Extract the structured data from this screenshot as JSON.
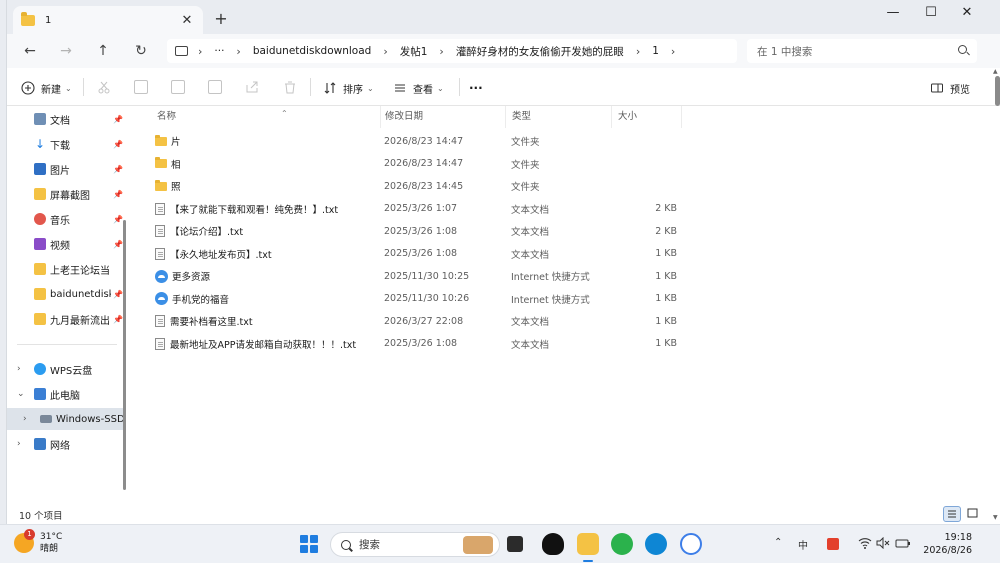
{
  "tab": {
    "title": "1",
    "close": "✕",
    "new_tab": "+"
  },
  "window_controls": {
    "minimize": "—",
    "maximize": "☐",
    "close": "✕"
  },
  "nav": {
    "back": "←",
    "forward": "→",
    "up": "↑",
    "refresh": "↻"
  },
  "address": {
    "ellipsis": "···",
    "crumbs": [
      "baidunetdiskdownload",
      "发帖1",
      "灌醉好身材的女友偷偷开发她的屁眼",
      "1"
    ],
    "sep": "›"
  },
  "search": {
    "placeholder": "在 1 中搜索"
  },
  "toolbar": {
    "new_label": "新建",
    "sort_label": "排序",
    "view_label": "查看",
    "more_label": "···",
    "preview_label": "预览"
  },
  "sidebar": {
    "quick": [
      {
        "label": "文档",
        "pin": "📌"
      },
      {
        "label": "下载",
        "pin": "📌"
      },
      {
        "label": "图片",
        "pin": "📌"
      },
      {
        "label": "屏幕截图",
        "pin": "📌"
      },
      {
        "label": "音乐",
        "pin": "📌"
      },
      {
        "label": "视频",
        "pin": "📌"
      },
      {
        "label": "上老王论坛当",
        "pin": ""
      },
      {
        "label": "baidunetdisk",
        "pin": "📌"
      },
      {
        "label": "九月最新流出",
        "pin": "📌"
      }
    ],
    "wps": "WPS云盘",
    "this_pc": "此电脑",
    "drive": "Windows-SSD",
    "network": "网络"
  },
  "columns": {
    "name": "名称",
    "date": "修改日期",
    "type": "类型",
    "size": "大小"
  },
  "files": [
    {
      "name": "片",
      "date": "2026/8/23 14:47",
      "type": "文件夹",
      "size": "",
      "kind": "folder"
    },
    {
      "name": "相",
      "date": "2026/8/23 14:47",
      "type": "文件夹",
      "size": "",
      "kind": "folder"
    },
    {
      "name": "照",
      "date": "2026/8/23 14:45",
      "type": "文件夹",
      "size": "",
      "kind": "folder"
    },
    {
      "name": "【来了就能下载和观看！纯免费！】.txt",
      "date": "2025/3/26 1:07",
      "type": "文本文档",
      "size": "2 KB",
      "kind": "txt"
    },
    {
      "name": "【论坛介绍】.txt",
      "date": "2025/3/26 1:08",
      "type": "文本文档",
      "size": "2 KB",
      "kind": "txt"
    },
    {
      "name": "【永久地址发布页】.txt",
      "date": "2025/3/26 1:08",
      "type": "文本文档",
      "size": "1 KB",
      "kind": "txt"
    },
    {
      "name": "更多资源",
      "date": "2025/11/30 10:25",
      "type": "Internet 快捷方式",
      "size": "1 KB",
      "kind": "link"
    },
    {
      "name": "手机党的福音",
      "date": "2025/11/30 10:26",
      "type": "Internet 快捷方式",
      "size": "1 KB",
      "kind": "link"
    },
    {
      "name": "需要补档看这里.txt",
      "date": "2026/3/27 22:08",
      "type": "文本文档",
      "size": "1 KB",
      "kind": "txt"
    },
    {
      "name": "最新地址及APP请发邮箱自动获取！！！.txt",
      "date": "2025/3/26 1:08",
      "type": "文本文档",
      "size": "1 KB",
      "kind": "txt"
    }
  ],
  "status": {
    "count": "10 个项目"
  },
  "taskbar": {
    "temp": "31°C",
    "weather": "晴朗",
    "weather_badge": "1",
    "search_label": "搜索",
    "ime": "中",
    "clock_time": "19:18",
    "clock_date": "2026/8/26"
  }
}
